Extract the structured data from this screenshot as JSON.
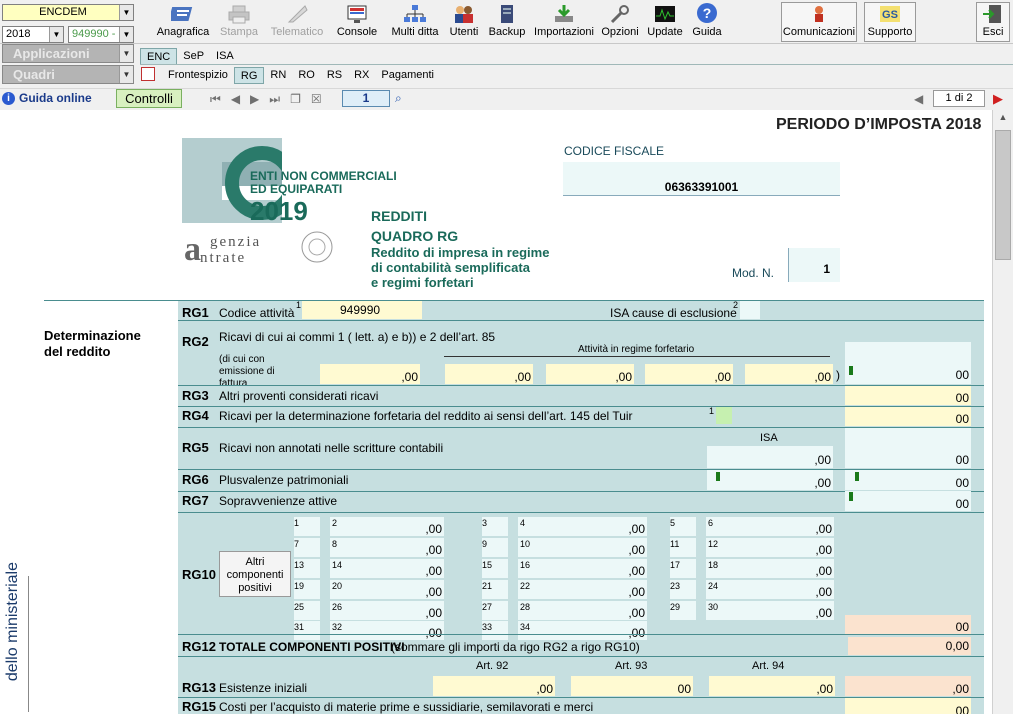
{
  "selectors": {
    "company": "ENCDEM",
    "year": "2018",
    "code": "949990 -",
    "apps": "Applicazioni",
    "quadri": "Quadri"
  },
  "toolbar": {
    "buttons": [
      "Anagrafica",
      "Stampa",
      "Telematico",
      "Console",
      "Multi ditta",
      "Utenti",
      "Backup",
      "Importazioni",
      "Opzioni",
      "Update",
      "Guida"
    ],
    "right_buttons": [
      "Comunicazioni",
      "Supporto",
      "Esci"
    ]
  },
  "tabs_top": [
    "ENC",
    "SeP",
    "ISA"
  ],
  "tabs_quadri": [
    "Frontespizio",
    "RG",
    "RN",
    "RO",
    "RS",
    "RX",
    "Pagamenti"
  ],
  "nav": {
    "guida_online": "Guida online",
    "controlli": "Controlli",
    "page_input": "1",
    "page_of": "1 di 2"
  },
  "form": {
    "periodo": "PERIODO D’IMPOSTA 2018",
    "codice_fiscale_label": "CODICE FISCALE",
    "codice_fiscale": "06363391001",
    "logo_title1": "ENTI NON COMMERCIALI",
    "logo_title2": "ED EQUIPARATI",
    "logo_year": "2019",
    "agenzia1": "genzia",
    "agenzia2": "ntrate",
    "redditi": "REDDITI",
    "quadro": "QUADRO RG",
    "desc1": "Reddito di impresa in regime",
    "desc2": "di contabilità semplificata",
    "desc3": "e regimi forfetari",
    "mod_label": "Mod. N.",
    "mod_value": "1",
    "section": "Determinazione del reddito",
    "side_text": "dello ministeriale",
    "altri_btn": "Altri componenti positivi",
    "rows": {
      "rg1": {
        "code": "RG1",
        "label": "Codice attività",
        "value": "949990",
        "isa": "ISA cause di esclusione"
      },
      "rg2": {
        "code": "RG2",
        "label": "Ricavi di cui ai commi 1 ( lett. a) e b)) e 2 dell’art. 85",
        "sub": "(di cui con emissione di fattura",
        "forf": "Attività in regime forfetario"
      },
      "rg3": {
        "code": "RG3",
        "label": "Altri proventi considerati ricavi"
      },
      "rg4": {
        "code": "RG4",
        "label": "Ricavi per la determinazione forfetaria del reddito ai sensi dell’art. 145 del Tuir"
      },
      "rg5": {
        "code": "RG5",
        "label": "Ricavi non annotati nelle scritture contabili",
        "isa": "ISA"
      },
      "rg6": {
        "code": "RG6",
        "label": "Plusvalenze patrimoniali"
      },
      "rg7": {
        "code": "RG7",
        "label": "Sopravvenienze attive"
      },
      "rg10": {
        "code": "RG10"
      },
      "rg12": {
        "code": "RG12",
        "label": "TOTALE COMPONENTI POSITIVI",
        "note": "(sommare gli importi da rigo RG2 a rigo RG10)",
        "value": "0,00"
      },
      "rg13": {
        "code": "RG13",
        "label": "Esistenze iniziali",
        "art92": "Art. 92",
        "art93": "Art. 93",
        "art94": "Art. 94"
      },
      "rg15": {
        "code": "RG15",
        "label": "Costi per l’acquisto di materie prime e sussidiarie, semilavorati e merci"
      }
    },
    "zero": ",00",
    "zero_full": "00"
  }
}
